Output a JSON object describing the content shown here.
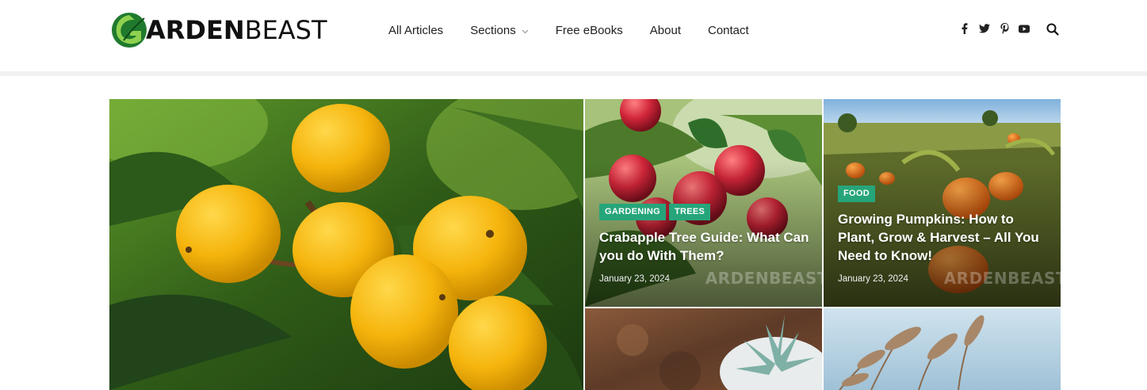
{
  "brand": {
    "logo_letter": "G",
    "logo_bold": "ARDEN",
    "logo_light": "BEAST",
    "accent_green": "#26a57a"
  },
  "nav": {
    "items": [
      {
        "label": "All Articles"
      },
      {
        "label": "Sections",
        "has_dropdown": true
      },
      {
        "label": "Free eBooks"
      },
      {
        "label": "About"
      },
      {
        "label": "Contact"
      }
    ]
  },
  "social": [
    "facebook-icon",
    "twitter-icon",
    "pinterest-icon",
    "youtube-icon"
  ],
  "search": {
    "icon": "search-icon"
  },
  "posts": [
    {
      "id": "featured",
      "image": "loquat fruits on branch"
    },
    {
      "id": "crabapple",
      "image": "red crabapples on tree",
      "categories": [
        "GARDENING",
        "TREES"
      ],
      "title": "Crabapple Tree Guide: What Can you do With Them?",
      "date": "January 23, 2024",
      "watermark": "ARDENBEAST"
    },
    {
      "id": "pumpkins",
      "image": "pumpkin field",
      "categories": [
        "FOOD"
      ],
      "title": "Growing Pumpkins: How to Plant, Grow & Harvest – All You Need to Know!",
      "date": "January 23, 2024",
      "watermark": "ARDENBEAST"
    },
    {
      "id": "succulent",
      "image": "succulent on rusty background"
    },
    {
      "id": "grass",
      "image": "pampas grass against sky"
    }
  ]
}
